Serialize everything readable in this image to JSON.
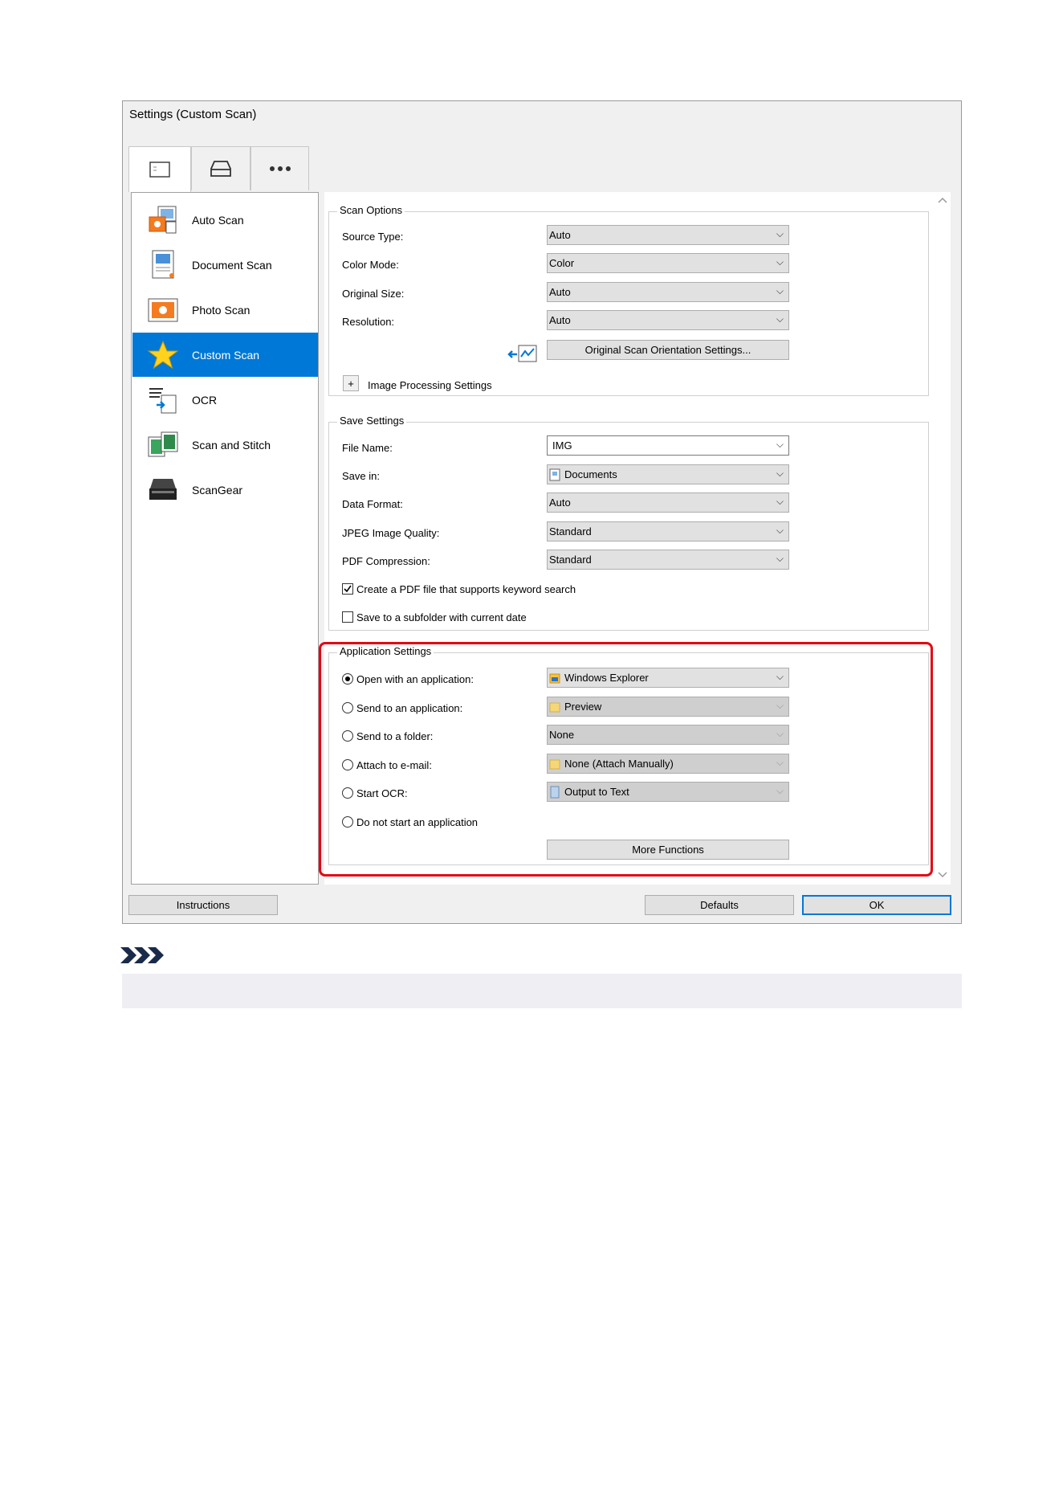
{
  "window": {
    "title": "Settings (Custom Scan)"
  },
  "tabs": [
    {
      "icon": "list-icon",
      "active": true
    },
    {
      "icon": "scanner-icon",
      "active": false
    },
    {
      "icon": "ellipsis-icon",
      "active": false
    }
  ],
  "sidebar": {
    "items": [
      {
        "label": "Auto Scan",
        "icon": "auto-scan-icon"
      },
      {
        "label": "Document Scan",
        "icon": "document-scan-icon"
      },
      {
        "label": "Photo Scan",
        "icon": "photo-scan-icon"
      },
      {
        "label": "Custom Scan",
        "icon": "star-icon",
        "selected": true
      },
      {
        "label": "OCR",
        "icon": "ocr-icon"
      },
      {
        "label": "Scan and Stitch",
        "icon": "stitch-icon"
      },
      {
        "label": "ScanGear",
        "icon": "scanner-icon"
      }
    ]
  },
  "scan_options": {
    "title": "Scan Options",
    "source_type": {
      "label": "Source Type:",
      "value": "Auto"
    },
    "color_mode": {
      "label": "Color Mode:",
      "value": "Color"
    },
    "original_size": {
      "label": "Original Size:",
      "value": "Auto"
    },
    "resolution": {
      "label": "Resolution:",
      "value": "Auto"
    },
    "orientation_button": "Original Scan Orientation Settings...",
    "image_processing_expander": "+",
    "image_processing_label": "Image Processing Settings"
  },
  "save_settings": {
    "title": "Save Settings",
    "file_name": {
      "label": "File Name:",
      "value": "IMG"
    },
    "save_in": {
      "label": "Save in:",
      "value": "Documents"
    },
    "data_format": {
      "label": "Data Format:",
      "value": "Auto"
    },
    "jpeg_quality": {
      "label": "JPEG Image Quality:",
      "value": "Standard"
    },
    "pdf_compression": {
      "label": "PDF Compression:",
      "value": "Standard"
    },
    "keyword_search": {
      "label": "Create a PDF file that supports keyword search",
      "checked": true
    },
    "subfolder_date": {
      "label": "Save to a subfolder with current date",
      "checked": false
    }
  },
  "application_settings": {
    "title": "Application Settings",
    "open_with_app": {
      "label": "Open with an application:",
      "value": "Windows Explorer",
      "selected": true
    },
    "send_to_app": {
      "label": "Send to an application:",
      "value": "Preview"
    },
    "send_to_folder": {
      "label": "Send to a folder:",
      "value": "None"
    },
    "attach_email": {
      "label": "Attach to e-mail:",
      "value": "None (Attach Manually)"
    },
    "start_ocr": {
      "label": "Start OCR:",
      "value": "Output to Text"
    },
    "no_app": {
      "label": "Do not start an application"
    },
    "more_functions": "More Functions"
  },
  "footer": {
    "instructions": "Instructions",
    "defaults": "Defaults",
    "ok": "OK"
  },
  "colors": {
    "selection": "#0078d7",
    "highlight_frame": "#e30613",
    "dialog_bg": "#f0f0f0"
  }
}
